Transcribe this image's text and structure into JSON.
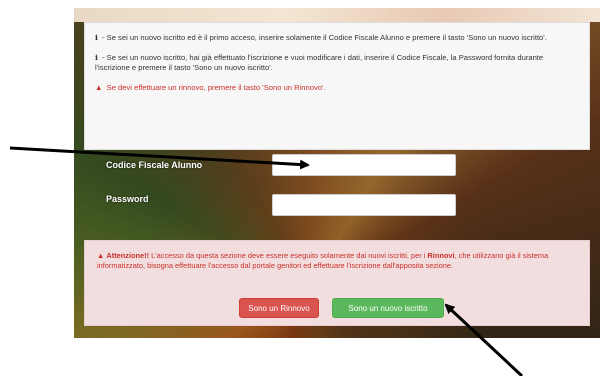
{
  "info": {
    "line1": "- Se sei un nuovo iscritto ed è il primo acceso, inserire solamente il Codice Fiscale Alunno e premere il tasto 'Sono un nuovo iscritto'.",
    "line2": "- Se sei un nuovo iscritto, hai già effettuato l'iscrizione e vuoi modificare i dati, inserire il Codice Fiscale, la Password fornita durante l'iscrizione e premere il tasto 'Sono un nuovo iscritto'.",
    "line3": "Se devi effettuare un rinnovo, premere il tasto 'Sono un Rinnovo'.",
    "info_icon": "i",
    "warning_icon": "▲"
  },
  "form": {
    "codice_label": "Codice Fiscale Alunno",
    "codice_value": "",
    "password_label": "Password",
    "password_value": ""
  },
  "alert": {
    "title": "Attenzione!!",
    "text": "L'accesso da questa sezione deve essere eseguito solamente dai nuovi iscritti, per i",
    "bold_word": "Rinnovi",
    "text2": ", che utilizzano già il sistema informatizzato, bisogna effettuare l'accesso dal portale genitori ed effettuare l'iscrizione dall'apposita sezione.",
    "warning_icon": "▲"
  },
  "buttons": {
    "rinnovo": "Sono un Rinnovo",
    "nuovo": "Sono un nuovo iscritto"
  },
  "colors": {
    "danger": "#d9534f",
    "success": "#5cb85c",
    "alert_bg": "#f2dede",
    "alert_text": "#c9302c"
  }
}
